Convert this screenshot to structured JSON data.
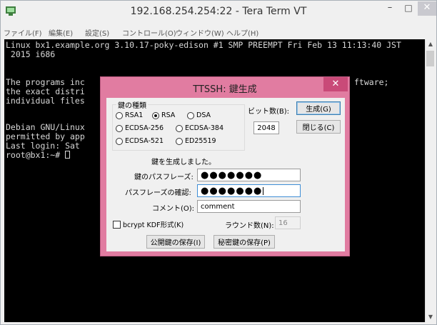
{
  "window": {
    "title": "192.168.254.254:22 - Tera Term VT",
    "icon": "tera-term-icon",
    "minimize_label": "–",
    "maximize_label": "□",
    "close_label": "✕"
  },
  "menu": {
    "items": [
      {
        "label": "ファイル(F)"
      },
      {
        "label": "編集(E)"
      },
      {
        "label": "設定(S)"
      },
      {
        "label": "コントロール(O)"
      },
      {
        "label": "ウィンドウ(W)"
      },
      {
        "label": "ヘルプ(H)"
      }
    ]
  },
  "terminal": {
    "lines": [
      "Linux bx1.example.org 3.10.17-poky-edison #1 SMP PREEMPT Fri Feb 13 11:13:40 JST",
      " 2015 i686",
      "",
      "The programs inc",
      "the exact distri",
      "individual files",
      "",
      "Debian GNU/Linux",
      "permitted by app",
      "Last login: Sat ",
      "root@bx1:~# "
    ],
    "right_text": "ftware;",
    "colors": {
      "background": "#000000",
      "foreground": "#d8d8d8"
    }
  },
  "dialog": {
    "title": "TTSSH: 鍵生成",
    "close_label": "✕",
    "accent_color": "#e17ca1",
    "key_type_group": "鍵の種類",
    "key_types": [
      {
        "label": "RSA1",
        "selected": false
      },
      {
        "label": "RSA",
        "selected": true
      },
      {
        "label": "DSA",
        "selected": false
      },
      {
        "label": "ECDSA-256",
        "selected": false
      },
      {
        "label": "ECDSA-384",
        "selected": false
      },
      {
        "label": "ECDSA-521",
        "selected": false
      },
      {
        "label": "ED25519",
        "selected": false
      }
    ],
    "bits_label": "ビット数(B):",
    "bits_value": "2048",
    "generate_button": "生成(G)",
    "close_button": "閉じる(C)",
    "status": "鍵を生成しました。",
    "passphrase_label": "鍵のパスフレーズ:",
    "passphrase_value": "●●●●●●●",
    "confirm_label": "パスフレーズの確認:",
    "confirm_value": "●●●●●●●",
    "comment_label": "コメント(O):",
    "comment_value": "comment",
    "bcrypt_label": "bcrypt KDF形式(K)",
    "bcrypt_checked": false,
    "rounds_label": "ラウンド数(N):",
    "rounds_value": "16",
    "save_public_button": "公開鍵の保存(I)",
    "save_private_button": "秘密鍵の保存(P)"
  }
}
